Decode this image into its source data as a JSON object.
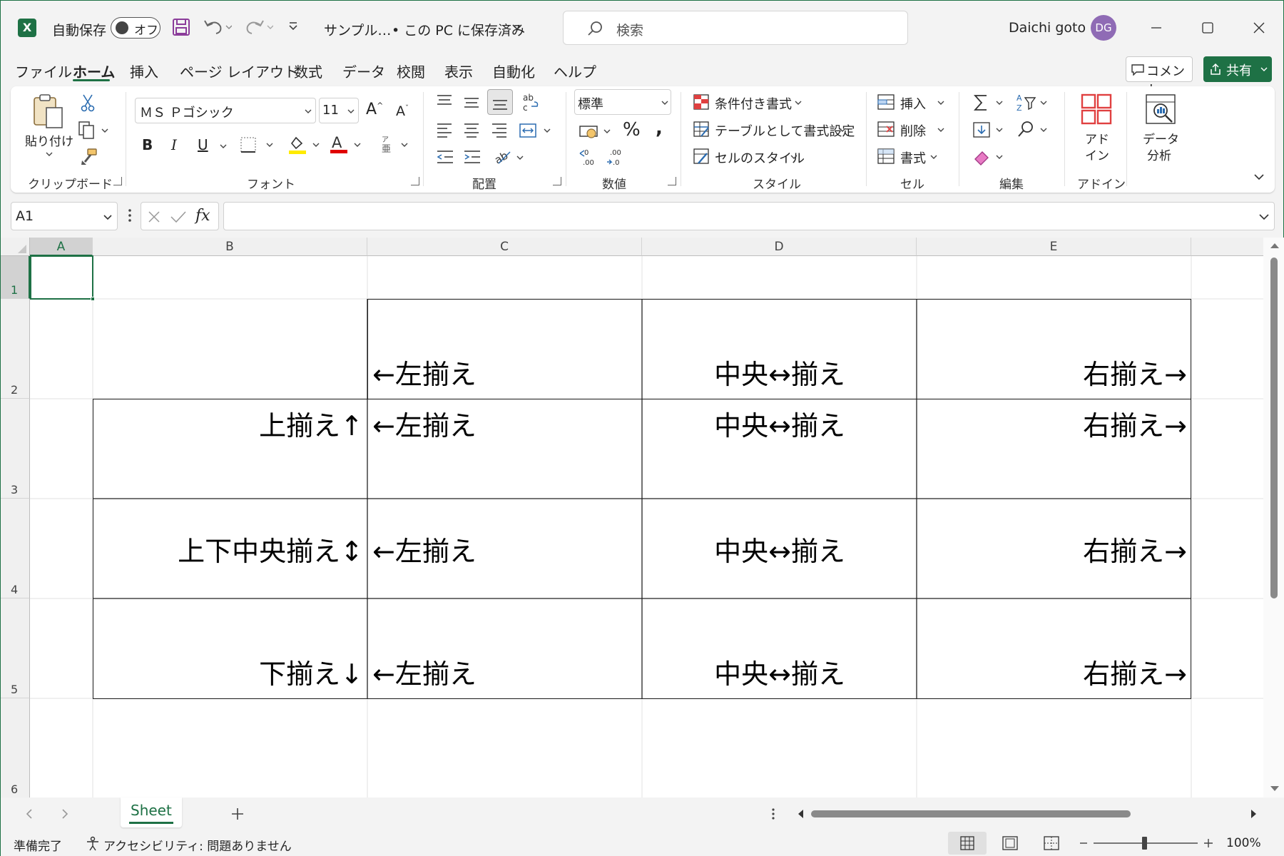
{
  "titlebar": {
    "autosave_label": "自動保存",
    "autosave_state": "オフ",
    "filename": "サンプル…",
    "save_status": "• この PC に保存済み",
    "search_placeholder": "検索",
    "user_name": "Daichi goto",
    "user_initials": "DG",
    "accent": "#1e7145",
    "avatar_color": "#8f6bb5"
  },
  "menu": {
    "tabs": [
      "ファイル",
      "ホーム",
      "挿入",
      "ページ レイアウト",
      "数式",
      "データ",
      "校閲",
      "表示",
      "自動化",
      "ヘルプ"
    ],
    "active": "ホーム",
    "comment_label": "コメント",
    "share_label": "共有"
  },
  "ribbon": {
    "clipboard": {
      "paste_label": "貼り付け",
      "group_label": "クリップボード"
    },
    "font": {
      "font_name": "ＭＳ Ｐゴシック",
      "font_size": "11",
      "group_label": "フォント"
    },
    "alignment": {
      "group_label": "配置"
    },
    "number": {
      "format": "標準",
      "group_label": "数値"
    },
    "styles": {
      "conditional": "条件付き書式",
      "table": "テーブルとして書式設定",
      "cell_styles": "セルのスタイル",
      "group_label": "スタイル"
    },
    "cells": {
      "insert": "挿入",
      "delete": "削除",
      "format": "書式",
      "group_label": "セル"
    },
    "editing": {
      "group_label": "編集"
    },
    "addins": {
      "addin_line1": "アド",
      "addin_line2": "イン",
      "analysis_line1": "データ",
      "analysis_line2": "分析",
      "group_label": "アドイン"
    }
  },
  "formula_bar": {
    "name_box": "A1",
    "formula": ""
  },
  "columns": [
    "A",
    "B",
    "C",
    "D",
    "E"
  ],
  "rows": [
    "1",
    "2",
    "3",
    "4",
    "5",
    "6"
  ],
  "cells": {
    "C2": "←左揃え",
    "D2": "中央↔揃え",
    "E2": "右揃え→",
    "B3": "上揃え↑",
    "C3": "←左揃え",
    "D3": "中央↔揃え",
    "E3": "右揃え→",
    "B4": "上下中央揃え↕",
    "C4": "←左揃え",
    "D4": "中央↔揃え",
    "E4": "右揃え→",
    "B5": "下揃え↓",
    "C5": "←左揃え",
    "D5": "中央↔揃え",
    "E5": "右揃え→"
  },
  "sheet_tab": "Sheet",
  "status": {
    "ready": "準備完了",
    "accessibility": "アクセシビリティ: 問題ありません",
    "zoom": "100%"
  }
}
